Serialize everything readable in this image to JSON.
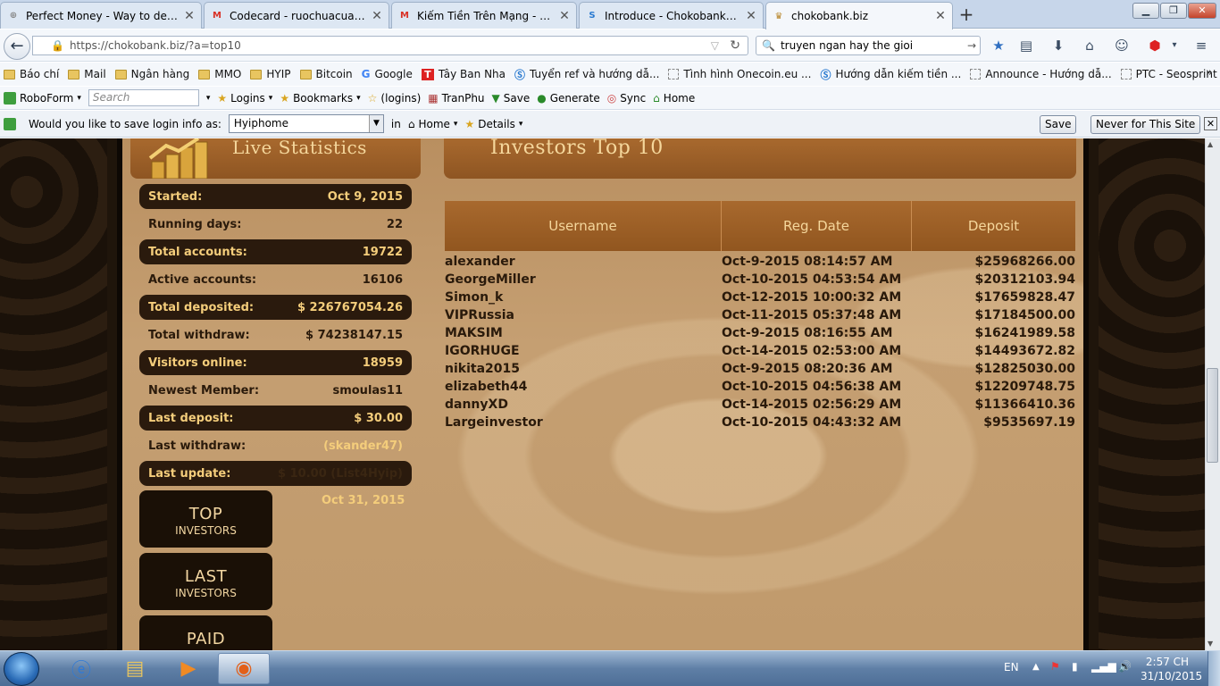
{
  "tabs": [
    {
      "title": "Perfect Money - Way to develo...",
      "icon": "pm-icon",
      "active": false
    },
    {
      "title": "Codecard - ruochuacuatun...",
      "icon": "gmail-icon",
      "active": false
    },
    {
      "title": "Kiếm Tiền Trên Mạng - Ma...",
      "icon": "gmail-icon",
      "active": false
    },
    {
      "title": "Introduce - Chokobank - c...",
      "icon": "chokobank-icon",
      "active": false
    },
    {
      "title": "chokobank.biz",
      "icon": "crown-icon",
      "active": true
    }
  ],
  "new_tab": "+",
  "nav": {
    "url": "https://chokobank.biz/?a=top10",
    "search_value": "truyen ngan hay the gioi",
    "back": "←"
  },
  "bookmarks": [
    {
      "label": "Báo chí",
      "icon": "folder"
    },
    {
      "label": "Mail",
      "icon": "folder"
    },
    {
      "label": "Ngân hàng",
      "icon": "folder"
    },
    {
      "label": "MMO",
      "icon": "folder"
    },
    {
      "label": "HYIP",
      "icon": "folder"
    },
    {
      "label": "Bitcoin",
      "icon": "folder"
    },
    {
      "label": "Google",
      "icon": "google"
    },
    {
      "label": "Tây Ban Nha",
      "icon": "t"
    },
    {
      "label": "Tuyển ref và hướng dẫ...",
      "icon": "s"
    },
    {
      "label": "Tình hình Onecoin.eu ...",
      "icon": "blank"
    },
    {
      "label": "Hướng dẫn kiếm tiền ...",
      "icon": "s"
    },
    {
      "label": "Announce - Hướng dẫ...",
      "icon": "blank"
    },
    {
      "label": "PTC - Seosprint - Hướ...",
      "icon": "blank"
    }
  ],
  "bookmarks_more": "»",
  "roboform": {
    "brand": "RoboForm",
    "search_placeholder": "Search",
    "logins": "Logins",
    "bookmarks": "Bookmarks",
    "logins_paren": "(logins)",
    "tranphu": "TranPhu",
    "save": "Save",
    "generate": "Generate",
    "sync": "Sync",
    "home": "Home"
  },
  "savebar": {
    "prompt": "Would you like to save login info as:",
    "select_value": "Hyiphome",
    "in": "in",
    "home": "Home",
    "details": "Details",
    "save_btn": "Save",
    "never_btn": "Never for This Site",
    "close": "✕"
  },
  "page": {
    "left_header": "Live Statistics",
    "right_header": "Investors Top 10",
    "stats": [
      {
        "label": "Started:",
        "value": "Oct 9, 2015",
        "dark": true
      },
      {
        "label": "Running days:",
        "value": "22",
        "dark": false
      },
      {
        "label": "Total accounts:",
        "value": "19722",
        "dark": true
      },
      {
        "label": "Active accounts:",
        "value": "16106",
        "dark": false
      },
      {
        "label": "Total deposited:",
        "value": "$ 226767054.26",
        "dark": true
      },
      {
        "label": "Total withdraw:",
        "value": "$ 74238147.15",
        "dark": false
      },
      {
        "label": "Visitors online:",
        "value": "18959",
        "dark": true
      },
      {
        "label": "Newest Member:",
        "value": "smoulas11",
        "dark": false
      },
      {
        "label": "Last deposit:",
        "value": "$ 30.00",
        "dark": true
      },
      {
        "label": "Last withdraw:",
        "value": "(skander47)",
        "dark": false
      },
      {
        "label": "Last update:",
        "value": "$ 10.00 (List4Hyip)",
        "dark": true
      }
    ],
    "last_update_date": "Oct 31, 2015",
    "nav_buttons": [
      {
        "big": "TOP",
        "small": "INVESTORS"
      },
      {
        "big": "LAST",
        "small": "INVESTORS"
      },
      {
        "big": "PAID",
        "small": ""
      }
    ],
    "table": {
      "headers": [
        "Username",
        "Reg. Date",
        "Deposit"
      ],
      "rows": [
        [
          "alexander",
          "Oct-9-2015 08:14:57 AM",
          "$25968266.00"
        ],
        [
          "GeorgeMiller",
          "Oct-10-2015 04:53:54 AM",
          "$20312103.94"
        ],
        [
          "Simon_k",
          "Oct-12-2015 10:00:32 AM",
          "$17659828.47"
        ],
        [
          "VIPRussia",
          "Oct-11-2015 05:37:48 AM",
          "$17184500.00"
        ],
        [
          "MAKSIM",
          "Oct-9-2015 08:16:55 AM",
          "$16241989.58"
        ],
        [
          "IGORHUGE",
          "Oct-14-2015 02:53:00 AM",
          "$14493672.82"
        ],
        [
          "nikita2015",
          "Oct-9-2015 08:20:36 AM",
          "$12825030.00"
        ],
        [
          "elizabeth44",
          "Oct-10-2015 04:56:38 AM",
          "$12209748.75"
        ],
        [
          "dannyXD",
          "Oct-14-2015 02:56:29 AM",
          "$11366410.36"
        ],
        [
          "Largeinvestor",
          "Oct-10-2015 04:43:32 AM",
          "$9535697.19"
        ]
      ]
    }
  },
  "taskbar": {
    "lang": "EN",
    "time": "2:57 CH",
    "date": "31/10/2015"
  },
  "colors": {
    "gold": "#f4cd7b",
    "header_brown": "#a8692e",
    "dark_pill": "#2a1a0d"
  }
}
